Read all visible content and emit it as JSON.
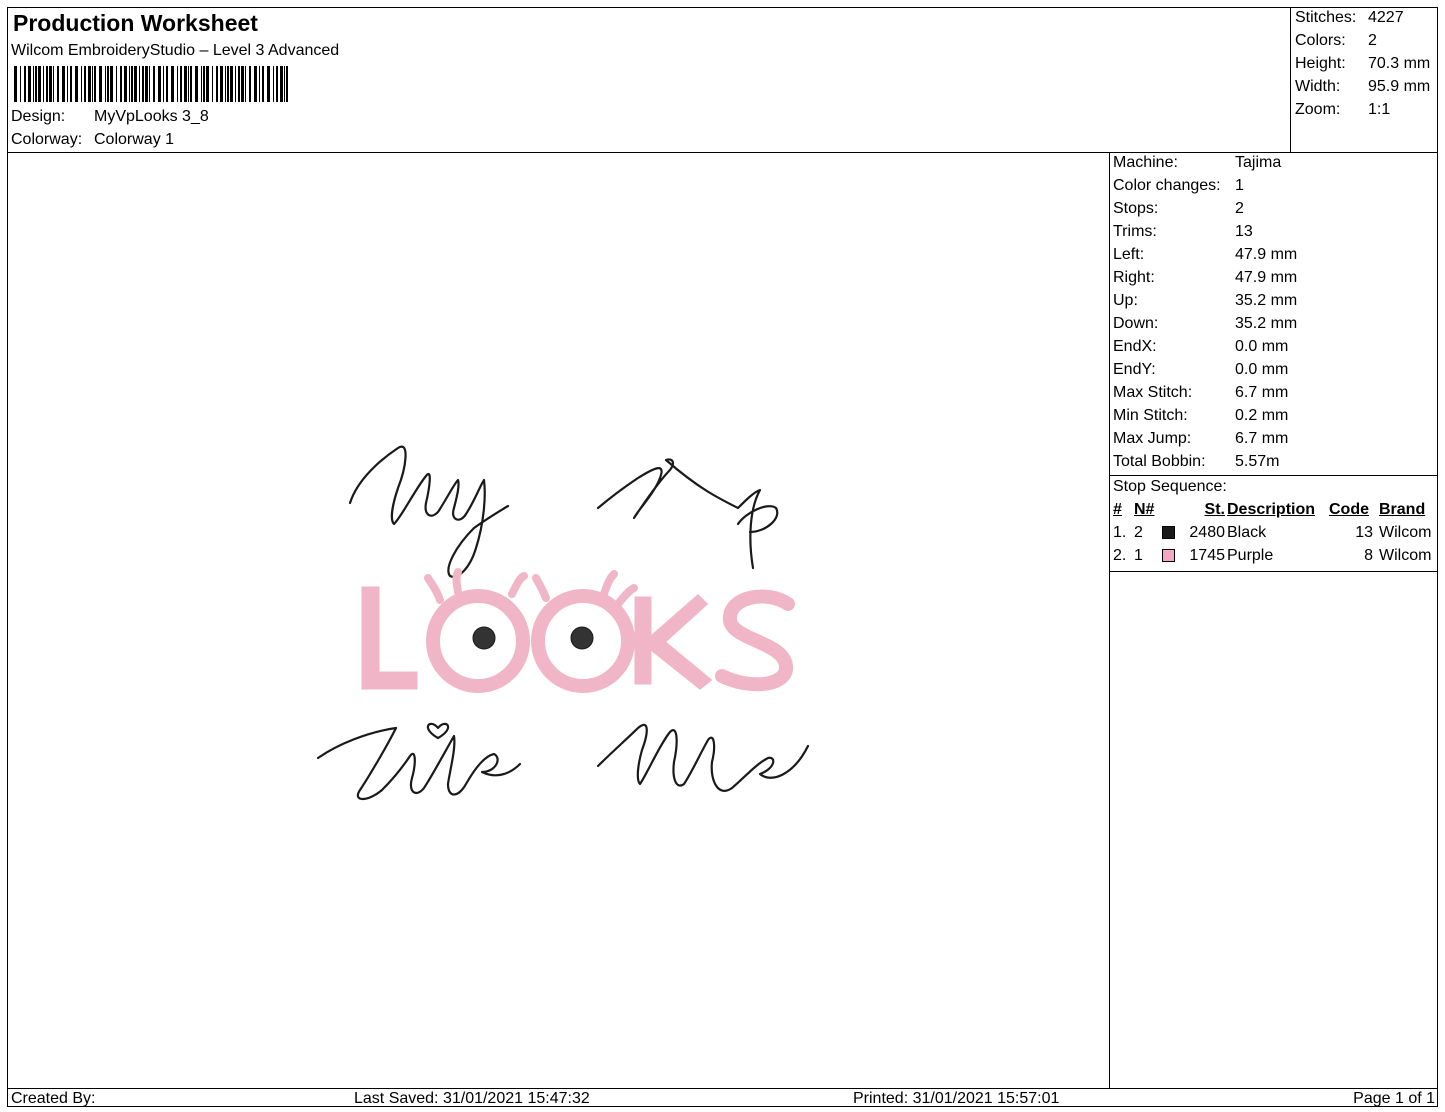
{
  "header": {
    "title": "Production Worksheet",
    "software": "Wilcom EmbroideryStudio – Level 3 Advanced",
    "barcode_icon": "barcode-icon",
    "design_label": "Design:",
    "design_value": "MyVpLooks 3_8",
    "colorway_label": "Colorway:",
    "colorway_value": "Colorway 1"
  },
  "summary": [
    {
      "label": "Stitches:",
      "value": "4227"
    },
    {
      "label": "Colors:",
      "value": "2"
    },
    {
      "label": "Height:",
      "value": "70.3 mm"
    },
    {
      "label": "Width:",
      "value": "95.9 mm"
    },
    {
      "label": "Zoom:",
      "value": "1:1"
    }
  ],
  "machine_info": [
    {
      "label": "Machine:",
      "value": "Tajima"
    },
    {
      "label": "Color changes:",
      "value": "1"
    },
    {
      "label": "Stops:",
      "value": "2"
    },
    {
      "label": "Trims:",
      "value": "13"
    },
    {
      "label": "Left:",
      "value": "47.9 mm"
    },
    {
      "label": "Right:",
      "value": "47.9 mm"
    },
    {
      "label": "Up:",
      "value": "35.2 mm"
    },
    {
      "label": "Down:",
      "value": "35.2 mm"
    },
    {
      "label": "EndX:",
      "value": "0.0 mm"
    },
    {
      "label": "EndY:",
      "value": "0.0 mm"
    },
    {
      "label": "Max Stitch:",
      "value": "6.7 mm"
    },
    {
      "label": "Min Stitch:",
      "value": "0.2 mm"
    },
    {
      "label": "Max Jump:",
      "value": "6.7 mm"
    },
    {
      "label": "Total Bobbin:",
      "value": "5.57m"
    }
  ],
  "stop_sequence": {
    "title": "Stop Sequence:",
    "headers": {
      "num": "#",
      "n": "N#",
      "st": "St.",
      "description": "Description",
      "code": "Code",
      "brand": "Brand"
    },
    "rows": [
      {
        "num": "1.",
        "n": "2",
        "color": "#1a1a1a",
        "st": "2480",
        "description": "Black",
        "code": "13",
        "brand": "Wilcom"
      },
      {
        "num": "2.",
        "n": "1",
        "color": "#f4a7c4",
        "st": "1745",
        "description": "Purple",
        "code": "8",
        "brand": "Wilcom"
      }
    ]
  },
  "design_preview": {
    "pink": "#f0b6c8",
    "pink_edge": "#d98aa6",
    "black": "#1a1a1a"
  },
  "footer": {
    "created_by": "Created By:",
    "last_saved": "Last Saved: 31/01/2021 15:47:32",
    "printed": "Printed: 31/01/2021 15:57:01",
    "page": "Page 1 of 1"
  }
}
